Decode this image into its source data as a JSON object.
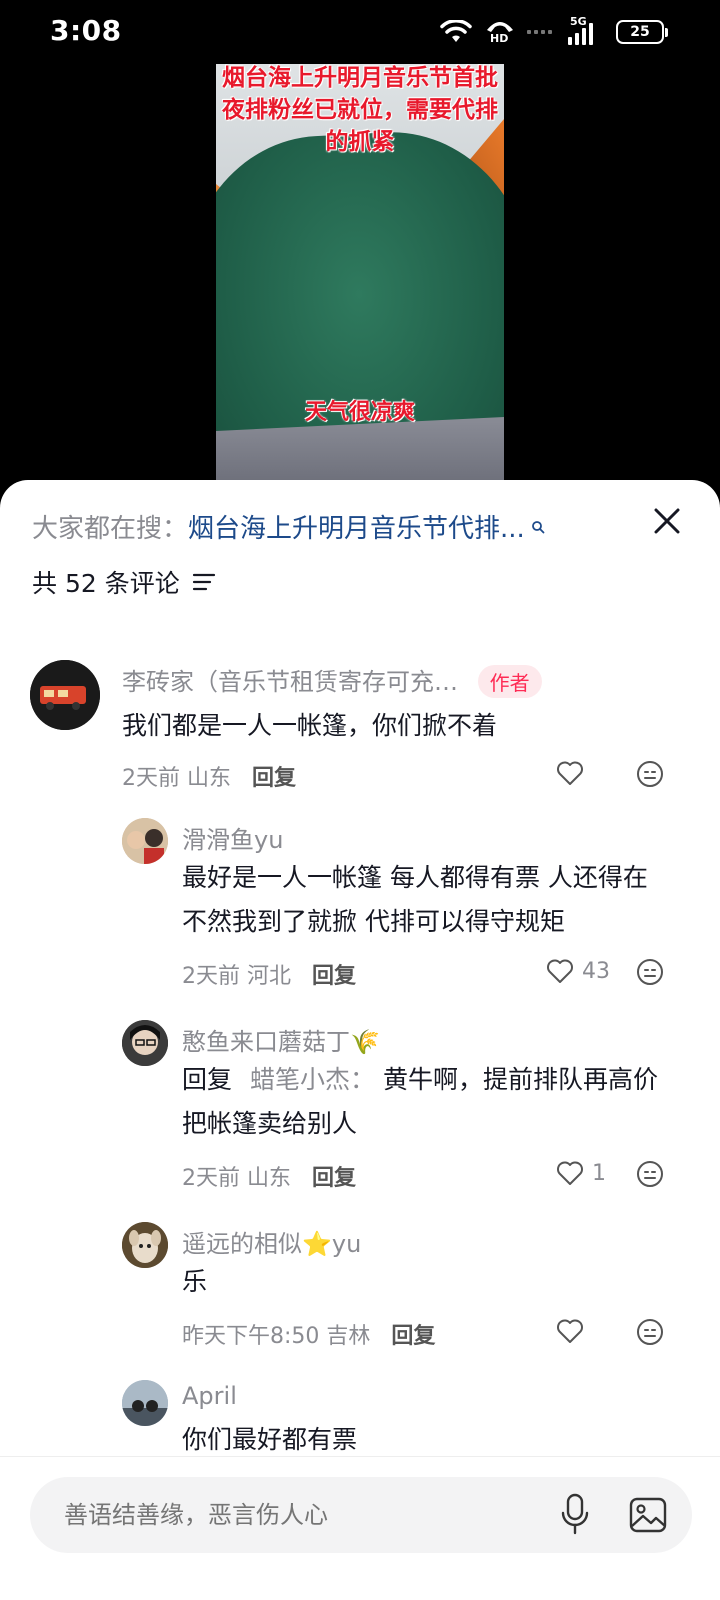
{
  "status_bar": {
    "time": "3:08",
    "network": "5G",
    "hd_label": "HD",
    "battery": "25"
  },
  "video": {
    "caption_top": "烟台海上升明月音乐节首批夜排粉丝已就位，需要代排的抓紧",
    "caption_bottom": "天气很凉爽"
  },
  "comment_sheet": {
    "search_prefix": "大家都在搜：",
    "search_query": "烟台海上升明月音乐节代排...",
    "comment_count_label": "共 52 条评论",
    "comments": [
      {
        "name": "李砖家（音乐节租赁寄存可充…",
        "badge": "作者",
        "text": "我们都是一人一帐篷，你们掀不着",
        "time": "2天前",
        "location": "山东",
        "reply_label": "回复",
        "likes": ""
      },
      {
        "name": "滑滑鱼yu",
        "text": "最好是一人一帐篷 每人都得有票 人还得在 不然我到了就掀 代排可以得守规矩",
        "time": "2天前",
        "location": "河北",
        "reply_label": "回复",
        "likes": "43"
      },
      {
        "name": "憨鱼来口蘑菇丁🌾",
        "reply_prefix": "回复",
        "reply_to": "蜡笔小杰：",
        "text": "黄牛啊，提前排队再高价把帐篷卖给别人",
        "time": "2天前",
        "location": "山东",
        "reply_label": "回复",
        "likes": "1"
      },
      {
        "name": "遥远的相似⭐yu",
        "text": "乐",
        "time": "昨天下午8:50",
        "location": "吉林",
        "reply_label": "回复",
        "likes": ""
      },
      {
        "name": "April",
        "text": "你们最好都有票"
      }
    ]
  },
  "input_bar": {
    "placeholder": "善语结善缘，恶言伤人心"
  },
  "icons": [
    "wifi-icon",
    "phone-hd-icon",
    "signal-icon",
    "battery-icon",
    "search-icon",
    "close-icon",
    "sort-icon",
    "heart-icon",
    "more-icon",
    "mic-icon",
    "image-icon"
  ],
  "colors": {
    "accent": "#fe2c55",
    "search_link": "#1d4a8a",
    "muted_text": "#8a8b91"
  }
}
